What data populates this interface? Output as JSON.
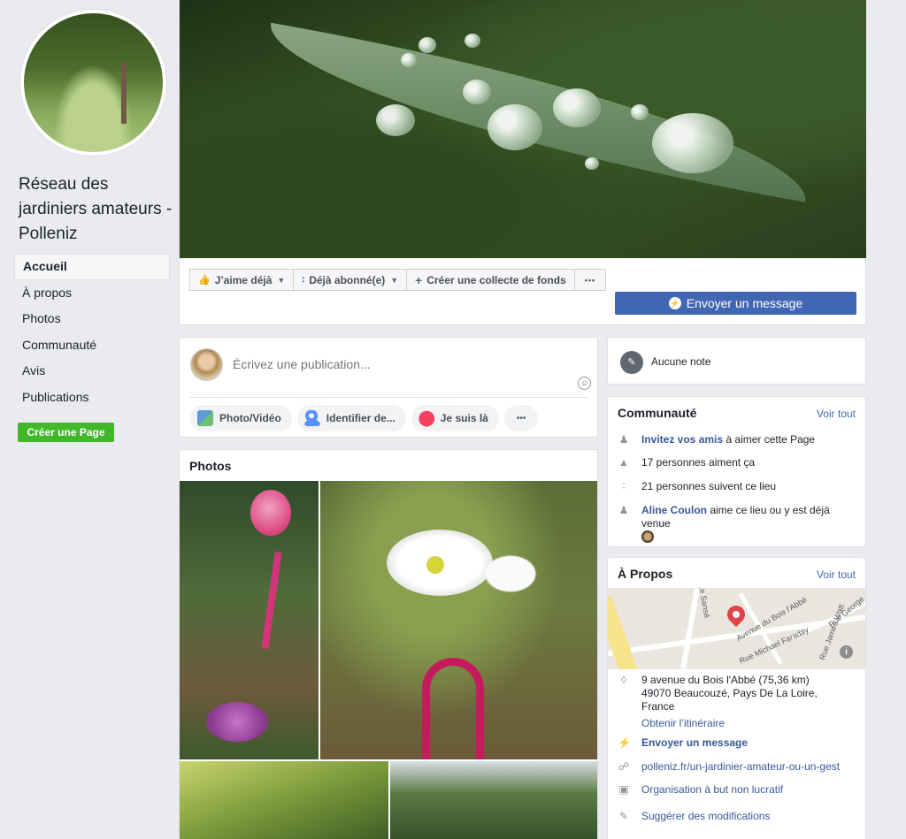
{
  "sidebar": {
    "page_name": "Réseau des jardiniers amateurs - Polleniz",
    "nav": [
      {
        "label": "Accueil",
        "active": true
      },
      {
        "label": "À propos"
      },
      {
        "label": "Photos"
      },
      {
        "label": "Communauté"
      },
      {
        "label": "Avis"
      },
      {
        "label": "Publications"
      }
    ],
    "create_page_label": "Créer une Page"
  },
  "cover_actions": {
    "like_label": "J’aime déjà",
    "follow_label": "Déjà abonné(e)",
    "fundraiser_label": "Créer une collecte de fonds",
    "more_label": "•••",
    "message_label": "Envoyer un message"
  },
  "composer": {
    "placeholder": "Écrivez une publication...",
    "chips": [
      {
        "label": "Photo/Vidéo",
        "icon": "photo-icon"
      },
      {
        "label": "Identifier de...",
        "icon": "tag-people-icon"
      },
      {
        "label": "Je suis là",
        "icon": "location-pin-icon"
      },
      {
        "label": "•••",
        "icon": "more-icon"
      }
    ]
  },
  "photos": {
    "title": "Photos"
  },
  "notes": {
    "text": "Aucune note"
  },
  "community": {
    "title": "Communauté",
    "see_all": "Voir tout",
    "invite_link": "Invitez vos amis",
    "invite_rest": " à aimer cette Page",
    "likes": "17 personnes aiment ça",
    "follows": "21 personnes suivent ce lieu",
    "friend_name": "Aline Coulon",
    "friend_rest": " aime ce lieu ou y est déjà venue"
  },
  "about": {
    "title": "À Propos",
    "see_all": "Voir tout",
    "map_labels": {
      "street1": "Avenue du Bois l'Abbé",
      "street2": "Rue Michael Faraday",
      "street3": "Rue James Watt",
      "street4": "Rue George",
      "street5": "Le Sansé"
    },
    "address_line1": "9 avenue du Bois l'Abbé (75,36 km)",
    "address_line2": "49070 Beaucouzé, Pays De La Loire,",
    "address_line3": "France",
    "directions": "Obtenir l’itinéraire",
    "message": "Envoyer un message",
    "website": "polleniz.fr/un-jardinier-amateur-ou-un-gest",
    "category": "Organisation à but non lucratif",
    "suggest": "Suggérer des modifications"
  },
  "colors": {
    "facebook_blue": "#4267b2",
    "link_blue": "#385898",
    "green_button": "#42b72a",
    "background": "#e9ebee"
  }
}
